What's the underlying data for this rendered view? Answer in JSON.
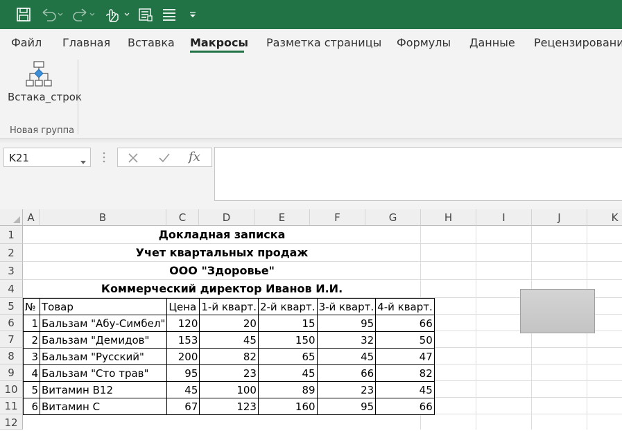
{
  "ribbon": {
    "tabs": [
      "Файл",
      "Главная",
      "Вставка",
      "Макросы",
      "Разметка страницы",
      "Формулы",
      "Данные",
      "Рецензирование"
    ],
    "active_tab": "Макросы",
    "macro_button_label": "Встака_строк",
    "group_label": "Новая группа"
  },
  "formula_bar": {
    "name_box": "K21",
    "formula": ""
  },
  "columns": [
    "A",
    "B",
    "C",
    "D",
    "E",
    "F",
    "G",
    "H",
    "I",
    "J",
    "K"
  ],
  "rows": [
    "1",
    "2",
    "3",
    "4",
    "5",
    "6",
    "7",
    "8",
    "9",
    "10",
    "11",
    "12"
  ],
  "sheet": {
    "title1": "Докладная записка",
    "title2": "Учет квартальных продаж",
    "title3": "ООО \"Здоровье\"",
    "title4": "Коммерческий директор Иванов И.И.",
    "headers": [
      "№",
      "Товар",
      "Цена",
      "1-й кварт.",
      "2-й кварт.",
      "3-й кварт.",
      "4-й кварт."
    ],
    "data": [
      [
        "1",
        "Бальзам \"Абу-Симбел\"",
        "120",
        "20",
        "15",
        "95",
        "66"
      ],
      [
        "2",
        "Бальзам \"Демидов\"",
        "153",
        "45",
        "150",
        "32",
        "50"
      ],
      [
        "3",
        "Бальзам \"Русский\"",
        "200",
        "82",
        "65",
        "45",
        "47"
      ],
      [
        "4",
        "Бальзам \"Сто трав\"",
        "95",
        "23",
        "45",
        "66",
        "82"
      ],
      [
        "5",
        "Витамин B12",
        "45",
        "100",
        "89",
        "23",
        "45"
      ],
      [
        "6",
        "Витамин C",
        "67",
        "123",
        "160",
        "95",
        "66"
      ]
    ]
  },
  "colors": {
    "accent": "#217346"
  }
}
